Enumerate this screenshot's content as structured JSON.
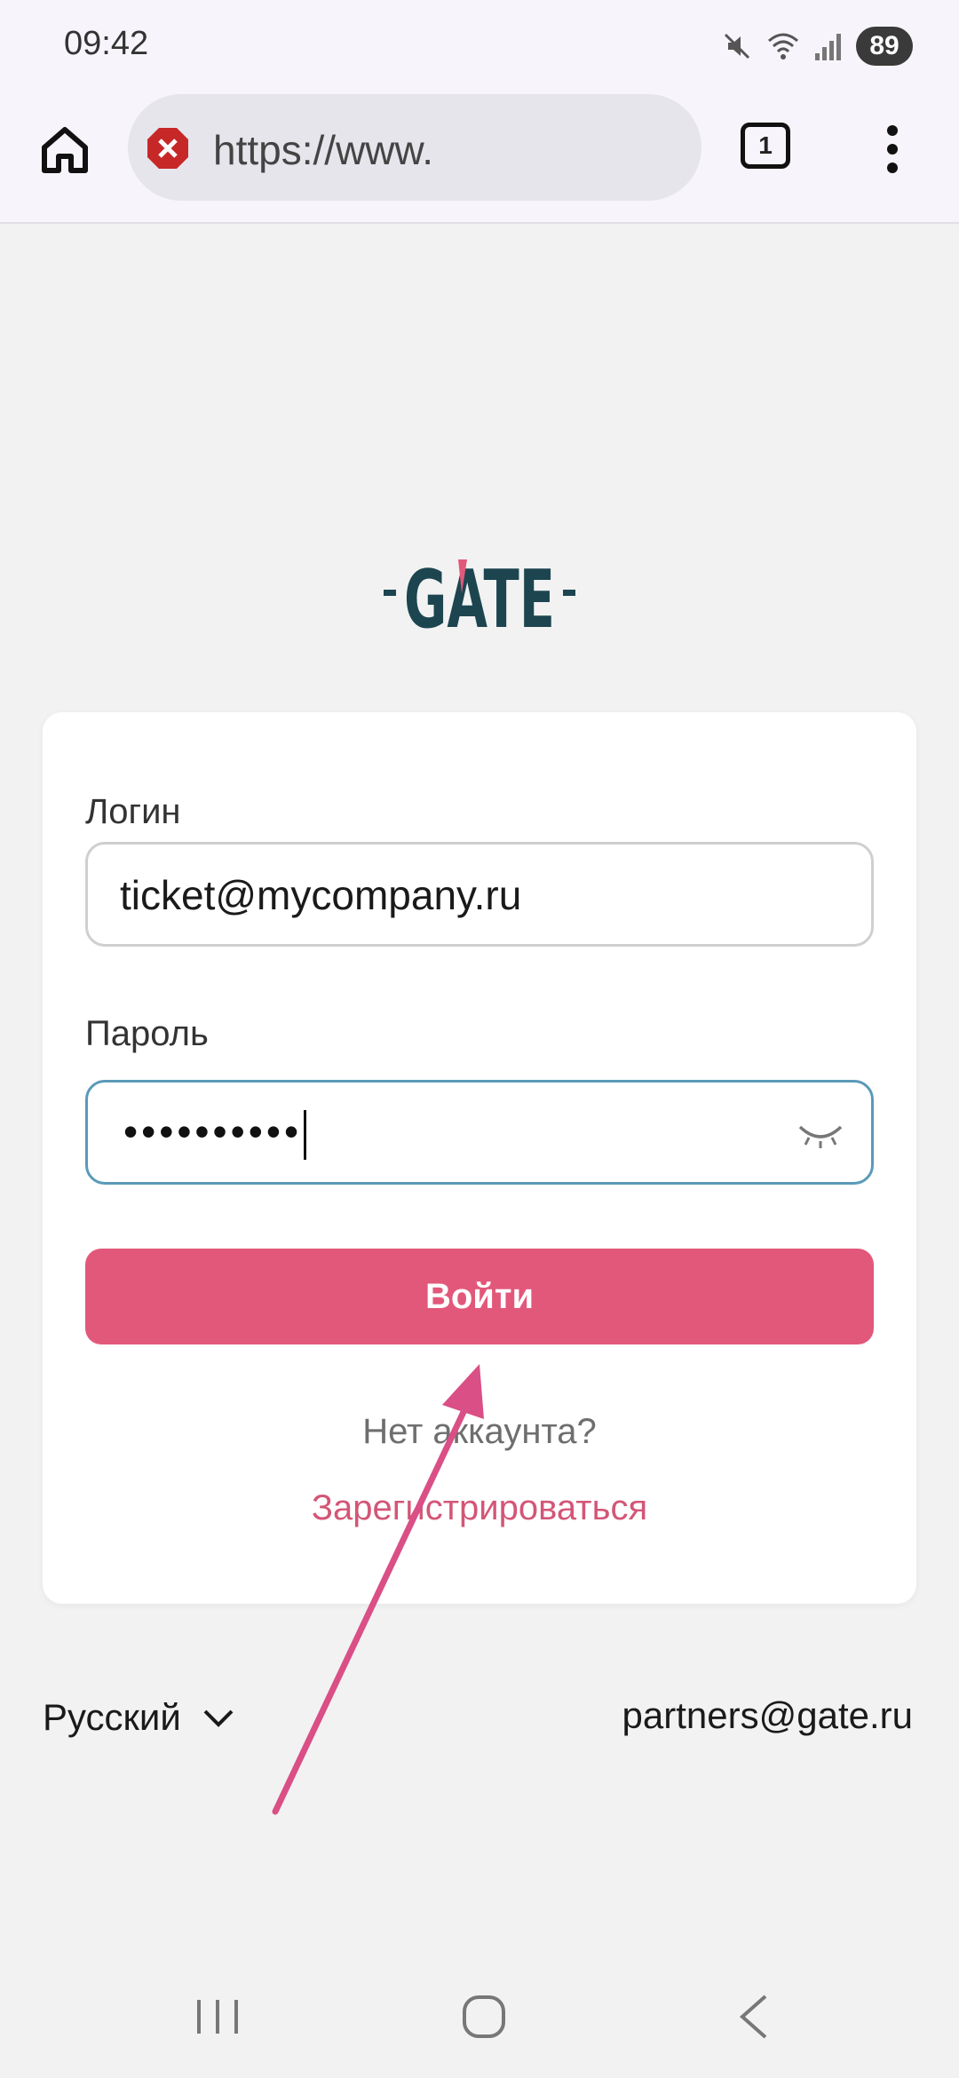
{
  "status_bar": {
    "time": "09:42",
    "battery": "89",
    "icons": [
      "mute-icon",
      "wifi-icon",
      "signal-icon",
      "battery-icon"
    ]
  },
  "browser": {
    "url": "https://www.",
    "tab_count": "1",
    "security_icon": "warning-icon",
    "colors": {
      "warning": "#c62828",
      "toolbar_bg": "#f7f5fb",
      "url_pill": "#e7e5ec"
    }
  },
  "page": {
    "logo_text": "GATE",
    "login": {
      "label": "Логин",
      "value": "ticket@mycompany.ru"
    },
    "password": {
      "label": "Пароль",
      "value": "••••••••••"
    },
    "submit_label": "Войти",
    "no_account_text": "Нет аккаунта?",
    "register_label": "Зарегистрироваться",
    "language": "Русский",
    "partners_email": "partners@gate.ru",
    "colors": {
      "accent": "#e2587a",
      "link": "#d35677",
      "logo": "#1c4550",
      "logo_accent": "#e2587a",
      "annotation_arrow": "#d94f86"
    }
  },
  "nav_bar": {
    "buttons": [
      "recent-apps-icon",
      "home-icon",
      "back-icon"
    ]
  }
}
